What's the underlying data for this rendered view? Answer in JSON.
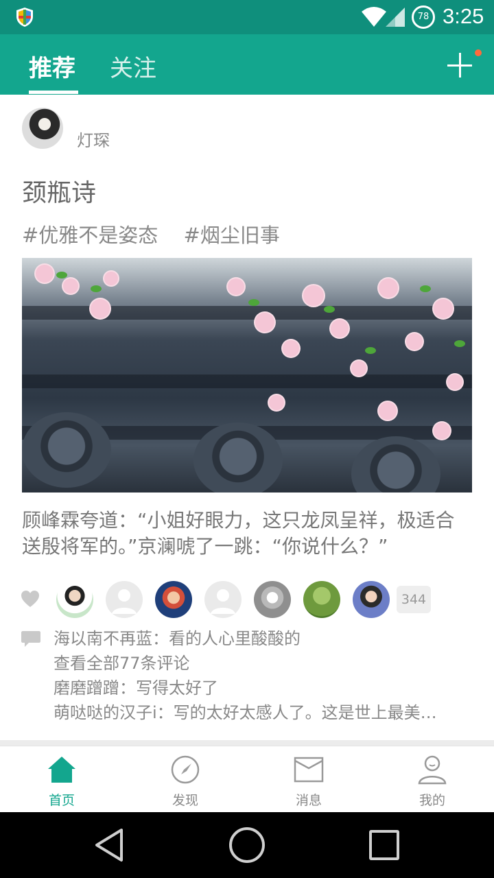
{
  "status_bar": {
    "battery_level": "78",
    "time": "3:25"
  },
  "header": {
    "tabs": [
      {
        "label": "推荐",
        "active": true
      },
      {
        "label": "关注",
        "active": false
      }
    ],
    "accent_color": "#13a68e",
    "notification_dot_color": "#ff6a3c"
  },
  "post": {
    "author": "灯琛",
    "title": "颈瓶诗",
    "tags": [
      "#优雅不是姿态",
      "#烟尘旧事"
    ],
    "image_icon": "flowers-over-roof-tiles",
    "body": "顾峰霖夸道：“小姐好眼力，这只龙凤呈祥，极适合送殷将军的。”京澜唬了一跳：“你说什么？”",
    "likes": {
      "avatar_count": 7,
      "count": "344"
    },
    "comments": [
      "海以南不再蓝：看的人心里酸酸的",
      "查看全部77条评论",
      "磨磨蹭蹭：写得太好了",
      "萌哒哒的汉子i：写的太好太感人了。这是世上最美…"
    ]
  },
  "bottom_nav": [
    {
      "label": "首页",
      "icon": "home-icon",
      "active": true
    },
    {
      "label": "发现",
      "icon": "compass-icon",
      "active": false
    },
    {
      "label": "消息",
      "icon": "message-icon",
      "active": false
    },
    {
      "label": "我的",
      "icon": "profile-icon",
      "active": false
    }
  ]
}
